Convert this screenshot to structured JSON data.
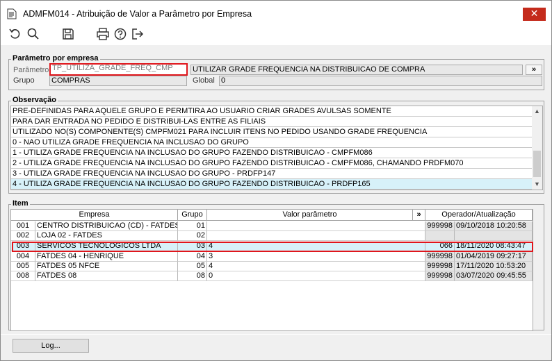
{
  "window": {
    "title": "ADMFM014 - Atribuição de Valor a Parâmetro por Empresa",
    "close_label": "✕"
  },
  "toolbar": {
    "icons": [
      "undo-icon",
      "search-icon",
      "save-icon",
      "print-icon",
      "help-icon",
      "exit-icon"
    ]
  },
  "parametro": {
    "legend": "Parâmetro por empresa",
    "parametro_label": "Parâmetro",
    "parametro_value": "TP_UTILIZA_GRADE_FREQ_CMP",
    "parametro_desc": "UTILIZAR GRADE FREQUENCIA NA DISTRIBUICAO DE COMPRA",
    "more_label": "»",
    "grupo_label": "Grupo",
    "grupo_value": "COMPRAS",
    "global_label": "Global",
    "global_value": "0"
  },
  "observacao": {
    "legend": "Observação",
    "lines": [
      "PRE-DEFINIDAS PARA AQUELE GRUPO E PERMTIRA AO USUARIO CRIAR GRADES AVULSAS SOMENTE",
      "PARA DAR ENTRADA NO PEDIDO E DISTRIBUI-LAS ENTRE AS FILIAIS",
      "UTILIZADO NO(S) COMPONENTE(S) CMPFM021  PARA INCLUIR ITENS NO PEDIDO USANDO GRADE FREQUENCIA",
      "0 - NAO UTILIZA GRADE FREQUENCIA NA INCLUSAO DO GRUPO",
      "1 - UTILIZA GRADE FREQUENCIA NA INCLUSAO DO GRUPO FAZENDO DISTRIBUICAO - CMPFM086",
      "2 - UTILIZA GRADE FREQUENCIA NA INCLUSAO DO GRUPO FAZENDO DISTRIBUICAO - CMPFM086, CHAMANDO PRDFM070",
      "3 - UTILIZA GRADE FREQUENCIA NA INCLUSAO DO GRUPO - PRDFP147",
      "4 - UTILIZA GRADE FREQUENCIA NA INCLUSAO DO GRUPO FAZENDO DISTRIBUICAO - PRDFP165"
    ],
    "selected_index": 7
  },
  "item": {
    "legend": "Item",
    "headers": {
      "empresa": "Empresa",
      "grupo": "Grupo",
      "valor": "Valor parâmetro",
      "more": "»",
      "operador": "Operador/Atualização"
    },
    "rows": [
      {
        "cod": "001",
        "nome": "CENTRO DISTRIBUICAO (CD) - FATDES",
        "grupo": "01",
        "valor": "",
        "operador": "999998",
        "data": "09/10/2018 10:20:58"
      },
      {
        "cod": "002",
        "nome": "LOJA 02 - FATDES",
        "grupo": "02",
        "valor": "",
        "operador": "",
        "data": ""
      },
      {
        "cod": "003",
        "nome": "SERVICOS TECNOLOGICOS LTDA",
        "grupo": "03",
        "valor": "4",
        "operador": "066",
        "data": "18/11/2020 08:43:47"
      },
      {
        "cod": "004",
        "nome": "FATDES 04 - HENRIQUE",
        "grupo": "04",
        "valor": "3",
        "operador": "999998",
        "data": "01/04/2019 09:27:17"
      },
      {
        "cod": "005",
        "nome": "FATDES 05 NFCE",
        "grupo": "05",
        "valor": "4",
        "operador": "999998",
        "data": "17/11/2020 10:53:20"
      },
      {
        "cod": "008",
        "nome": "FATDES 08",
        "grupo": "08",
        "valor": "0",
        "operador": "999998",
        "data": "03/07/2020 09:45:55"
      }
    ],
    "selected_index": 2
  },
  "footer": {
    "log_label": "Log..."
  }
}
